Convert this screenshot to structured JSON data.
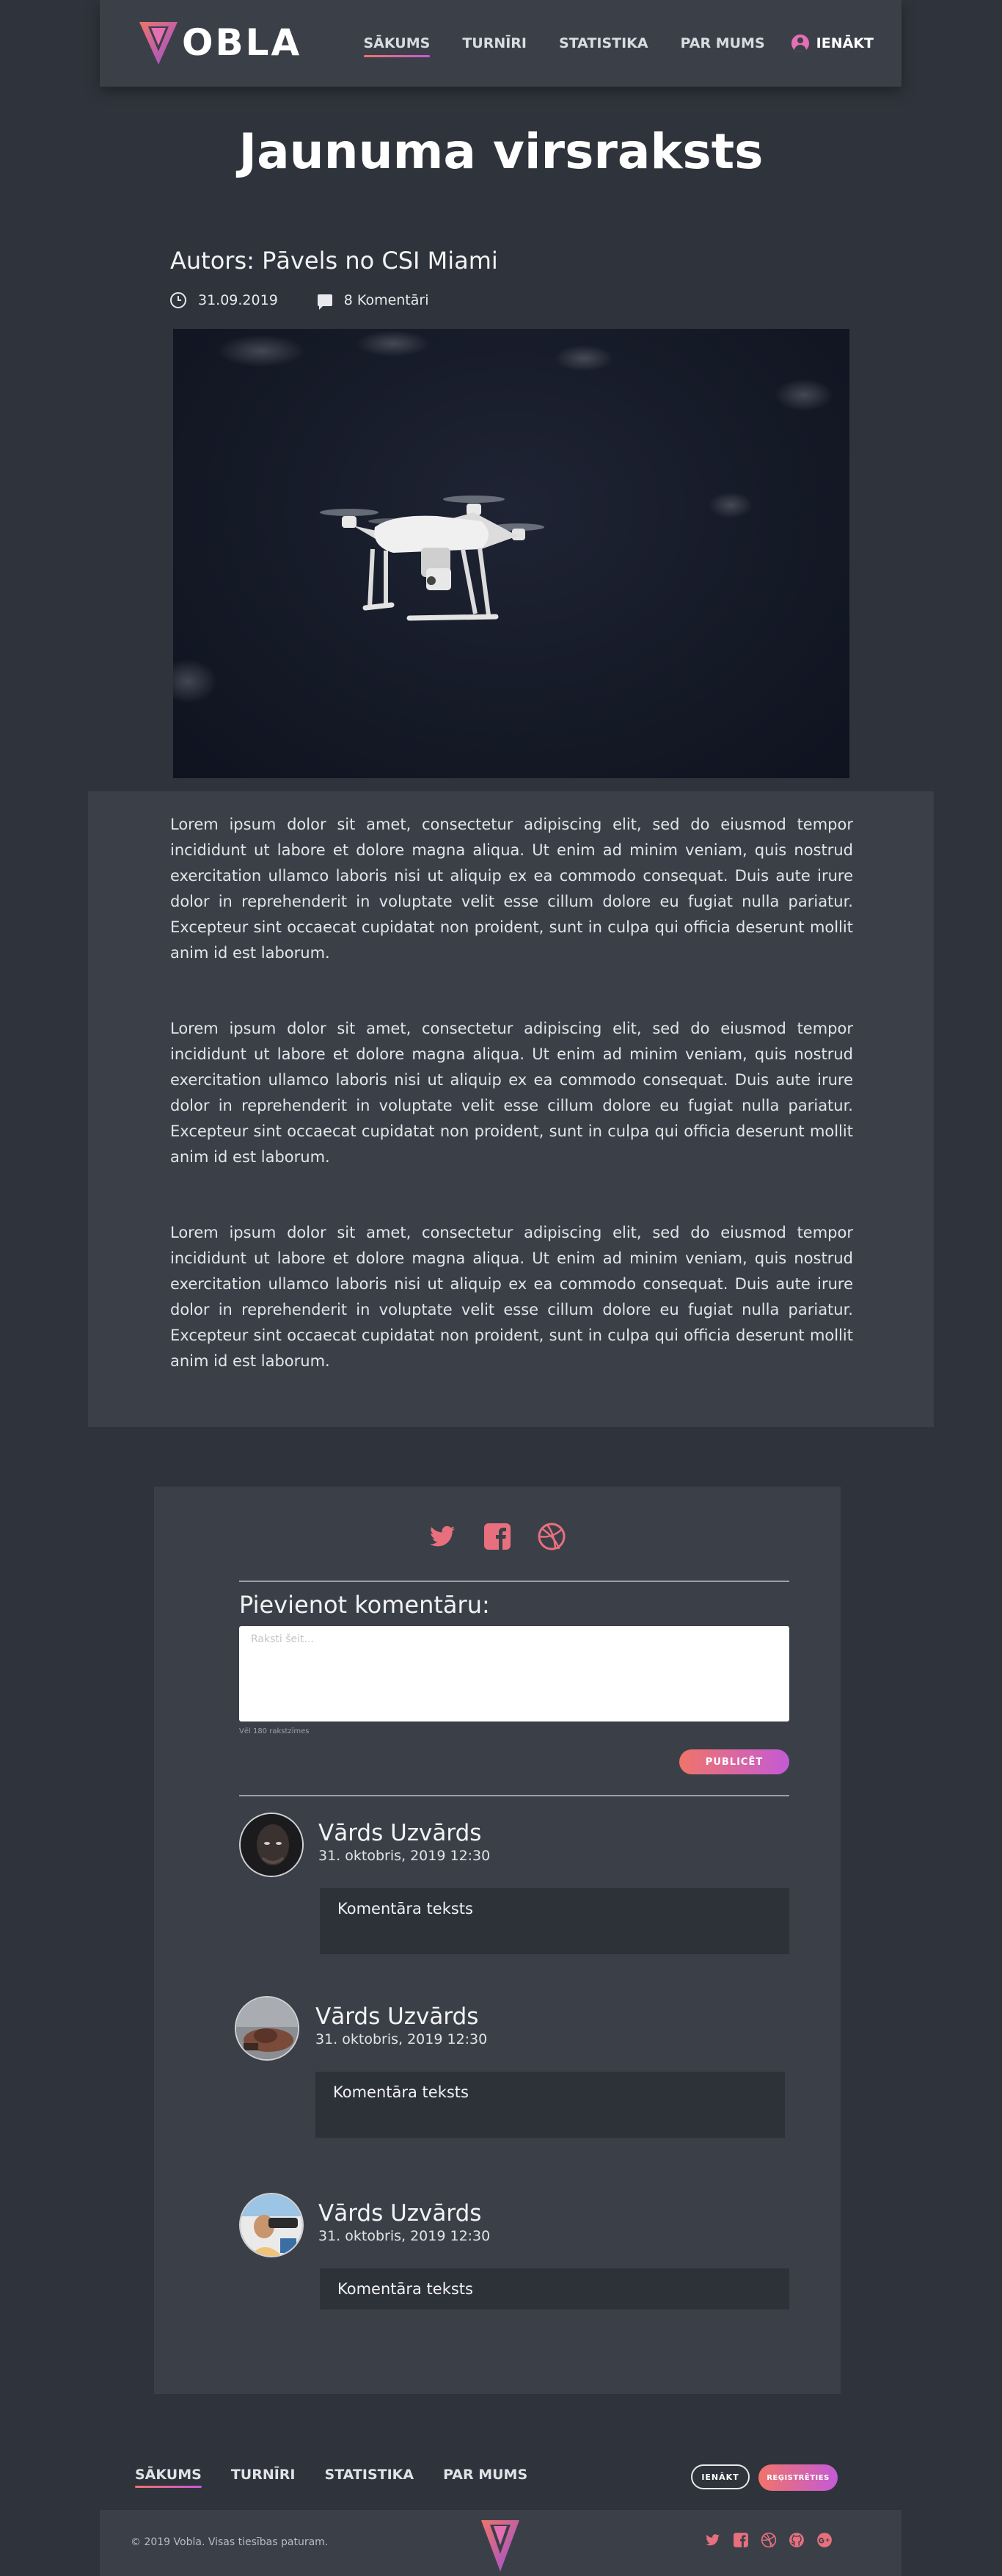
{
  "header": {
    "logo_text": "OBLA",
    "logo_letter": "V",
    "nav": [
      {
        "label": "SĀKUMS",
        "active": true
      },
      {
        "label": "TURNĪRI",
        "active": false
      },
      {
        "label": "STATISTIKA",
        "active": false
      },
      {
        "label": "PAR MUMS",
        "active": false
      }
    ],
    "login_label": "IENĀKT"
  },
  "article": {
    "title": "Jaunuma virsraksts",
    "author": "Autors: Pāvels no CSI Miami",
    "date": "31.09.2019",
    "comments_count": "8 Komentāri",
    "paragraphs": [
      "Lorem ipsum dolor sit amet, consectetur adipiscing elit, sed do eiusmod tempor incididunt ut labore et dolore magna aliqua. Ut enim ad minim veniam, quis nostrud exercitation ullamco laboris nisi ut aliquip ex ea commodo consequat. Duis aute irure dolor in reprehenderit in voluptate velit esse cillum dolore eu fugiat nulla pariatur. Excepteur sint occaecat cupidatat non proident, sunt in culpa qui officia deserunt mollit anim id est laborum.",
      "Lorem ipsum dolor sit amet, consectetur adipiscing elit, sed do eiusmod tempor incididunt ut labore et dolore magna aliqua. Ut enim ad minim veniam, quis nostrud exercitation ullamco laboris nisi ut aliquip ex ea commodo consequat. Duis aute irure dolor in reprehenderit in voluptate velit esse cillum dolore eu fugiat nulla pariatur. Excepteur sint occaecat cupidatat non proident, sunt in culpa qui officia deserunt mollit anim id est laborum.",
      "Lorem ipsum dolor sit amet, consectetur adipiscing elit, sed do eiusmod tempor incididunt ut labore et dolore magna aliqua. Ut enim ad minim veniam, quis nostrud exercitation ullamco laboris nisi ut aliquip ex ea commodo consequat. Duis aute irure dolor in reprehenderit in voluptate velit esse cillum dolore eu fugiat nulla pariatur. Excepteur sint occaecat cupidatat non proident, sunt in culpa qui officia deserunt mollit anim id est laborum."
    ]
  },
  "comments": {
    "add_title": "Pievienot komentāru:",
    "placeholder": "Raksti šeit...",
    "chars_hint": "Vēl 180 rakstzīmes",
    "publish_label": "PUBLICĒT",
    "items": [
      {
        "name": "Vārds Uzvārds",
        "date": "31. oktobris, 2019 12:30",
        "text": "Komentāra teksts"
      },
      {
        "name": "Vārds Uzvārds",
        "date": "31. oktobris, 2019 12:30",
        "text": "Komentāra teksts"
      },
      {
        "name": "Vārds Uzvārds",
        "date": "31. oktobris, 2019 12:30",
        "text": "Komentāra teksts"
      }
    ]
  },
  "footer": {
    "nav": [
      {
        "label": "SĀKUMS",
        "active": true
      },
      {
        "label": "TURNĪRI",
        "active": false
      },
      {
        "label": "STATISTIKA",
        "active": false
      },
      {
        "label": "PAR MUMS",
        "active": false
      }
    ],
    "login_label": "IENĀKT",
    "register_label": "REĢISTRĒTIES",
    "copyright": "© 2019 Vobla. Visas tiesības paturam."
  },
  "icons": {
    "share": [
      "twitter-icon",
      "facebook-icon",
      "dribbble-icon"
    ],
    "footer_social": [
      "twitter-icon",
      "facebook-icon",
      "dribbble-icon",
      "github-icon",
      "google-plus-icon"
    ]
  },
  "colors": {
    "background": "#2f333b",
    "panel": "#3b4048",
    "accent_start": "#f0746a",
    "accent_end": "#c45ad6",
    "social_icon": "#e8707e"
  }
}
